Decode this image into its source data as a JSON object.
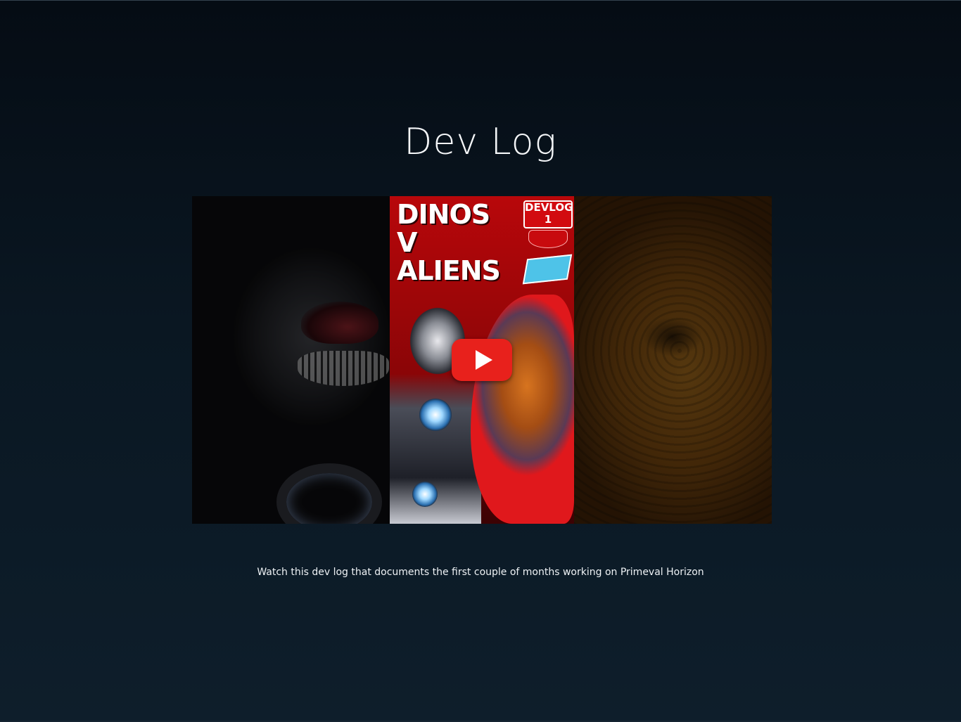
{
  "page": {
    "title": "Dev Log",
    "caption": "Watch this dev log that documents the first couple of months working on Primeval Horizon"
  },
  "video": {
    "thumbnail": {
      "headline": [
        "DINOS",
        "V",
        "ALIENS"
      ],
      "badge_line1": "DEVLOG",
      "badge_line2": "1"
    },
    "play_icon": "youtube-play-icon",
    "colors": {
      "play_button": "#e8211c",
      "thumbnail_red": "#b8070a"
    }
  },
  "colors": {
    "background_top": "#050c14",
    "background_bottom": "#0e1e2b",
    "text": "#ffffff"
  }
}
